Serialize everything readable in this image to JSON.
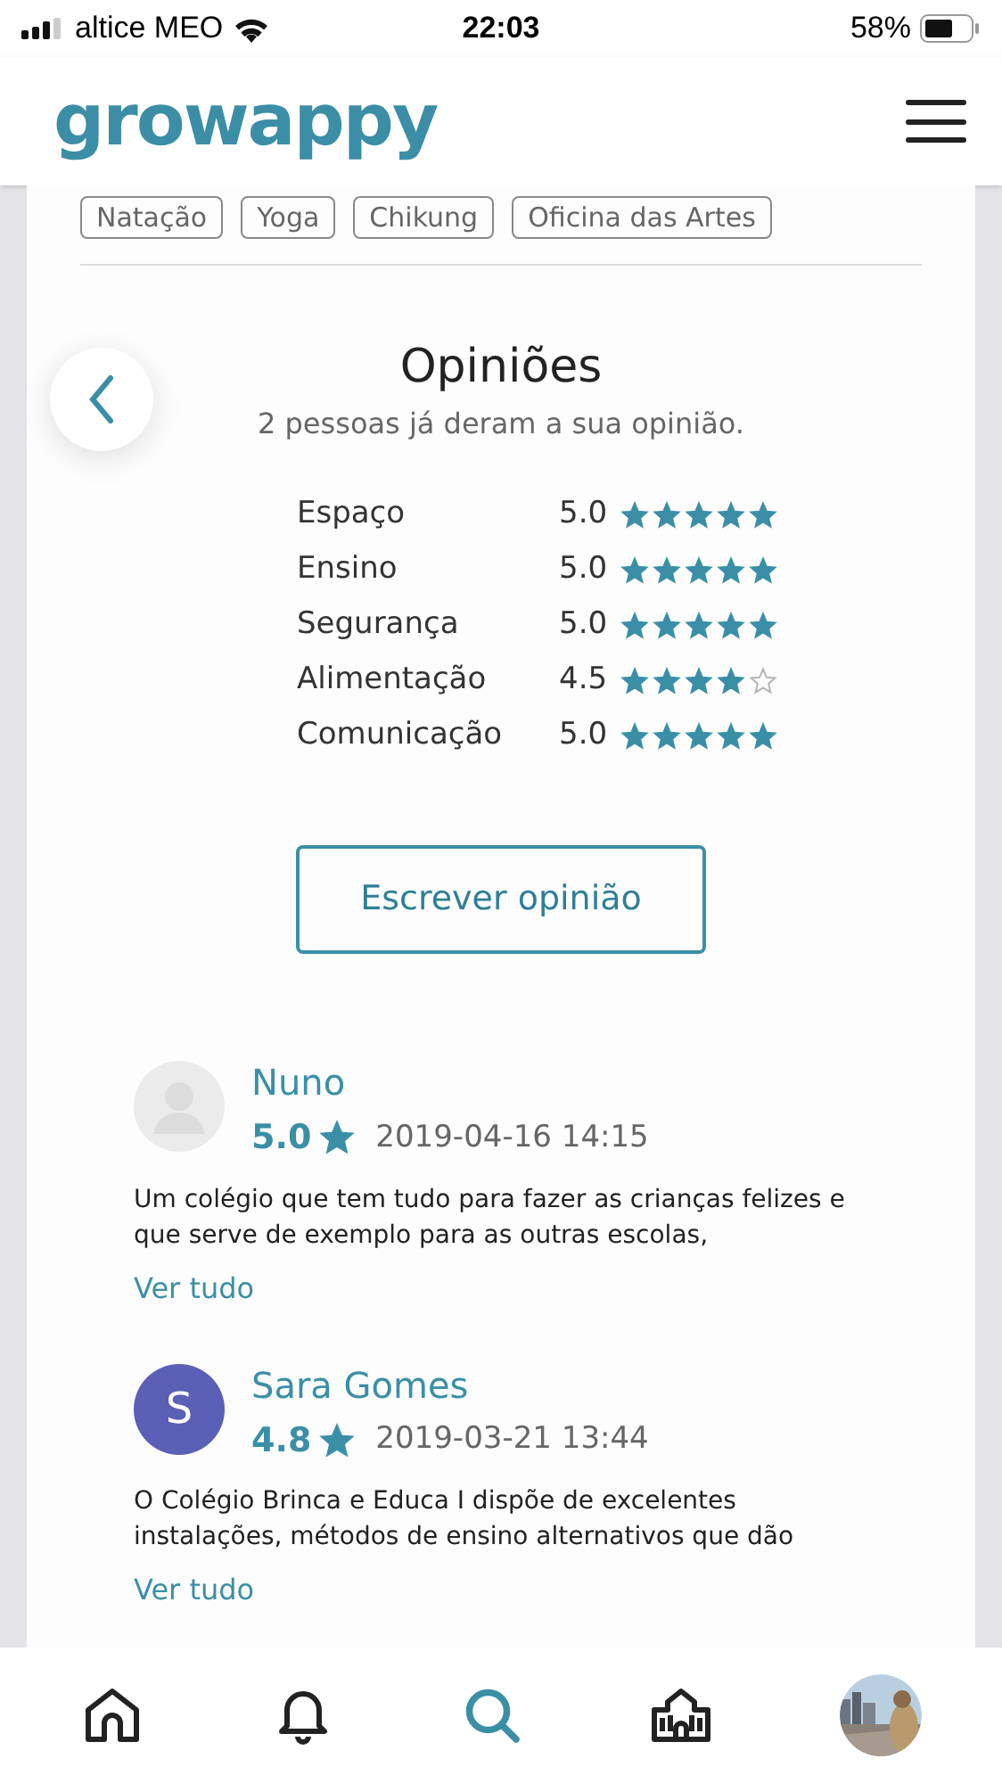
{
  "status_bar": {
    "carrier": "altice MEO",
    "time": "22:03",
    "battery": "58%"
  },
  "header": {
    "logo": "growappy"
  },
  "tags": [
    "Natação",
    "Yoga",
    "Chikung",
    "Oficina das Artes"
  ],
  "opinions": {
    "title": "Opiniões",
    "subtitle": "2 pessoas já deram a sua opinião.",
    "categories": [
      {
        "label": "Espaço",
        "score": "5.0",
        "stars": 5
      },
      {
        "label": "Ensino",
        "score": "5.0",
        "stars": 5
      },
      {
        "label": "Segurança",
        "score": "5.0",
        "stars": 5
      },
      {
        "label": "Alimentação",
        "score": "4.5",
        "stars": 4
      },
      {
        "label": "Comunicação",
        "score": "5.0",
        "stars": 5
      }
    ],
    "write_button": "Escrever opinião"
  },
  "reviews": [
    {
      "name": "Nuno",
      "avatar": {
        "kind": "placeholder"
      },
      "score": "5.0",
      "date": "2019-04-16 14:15",
      "text": "Um colégio que tem tudo para fazer as crianças felizes e que serve de exemplo para as outras escolas,",
      "more": "Ver tudo"
    },
    {
      "name": "Sara Gomes",
      "avatar": {
        "kind": "initial",
        "letter": "S",
        "color": "#5b5fb5"
      },
      "score": "4.8",
      "date": "2019-03-21 13:44",
      "text": "O Colégio Brinca e Educa I dispõe de excelentes instalações, métodos de ensino alternativos que dão",
      "more": "Ver tudo"
    }
  ],
  "bottom_nav": [
    {
      "kind": "home",
      "selected": false
    },
    {
      "kind": "notifications",
      "selected": false
    },
    {
      "kind": "search",
      "selected": true
    },
    {
      "kind": "school",
      "selected": false
    },
    {
      "kind": "profile",
      "selected": false
    }
  ]
}
